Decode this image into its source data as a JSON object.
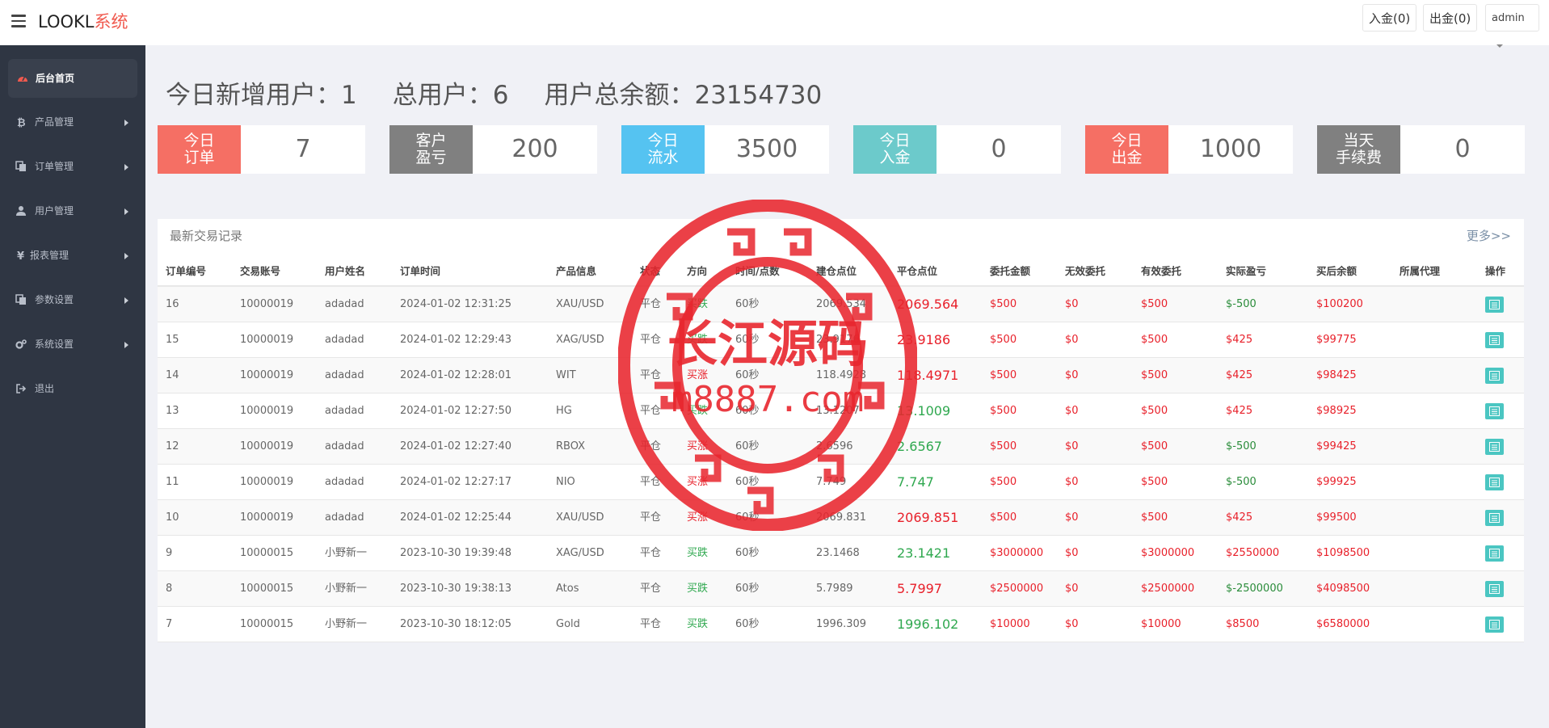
{
  "header": {
    "brand_main": "LOOKL",
    "brand_accent": "系统",
    "deposit_label": "入金(0)",
    "withdraw_label": "出金(0)",
    "admin_label": "admin"
  },
  "sidebar": {
    "items": [
      {
        "label": "后台首页",
        "icon": "dashboard-icon"
      },
      {
        "label": "产品管理",
        "icon": "bitcoin-icon"
      },
      {
        "label": "订单管理",
        "icon": "copy-icon"
      },
      {
        "label": "用户管理",
        "icon": "user-icon"
      },
      {
        "label": "报表管理",
        "icon": "yen-icon"
      },
      {
        "label": "参数设置",
        "icon": "copy-icon"
      },
      {
        "label": "系统设置",
        "icon": "cogs-icon"
      },
      {
        "label": "退出",
        "icon": "logout-icon"
      }
    ]
  },
  "stats": {
    "new_users": "今日新增用户：1",
    "total_users": "总用户：6",
    "total_balance": "用户总余额：23154730"
  },
  "cards": [
    {
      "label": "今日\n订单",
      "value": "7",
      "color": "#f56f64"
    },
    {
      "label": "客户\n盈亏",
      "value": "200",
      "color": "#808080"
    },
    {
      "label": "今日\n流水",
      "value": "3500",
      "color": "#55c3f1"
    },
    {
      "label": "今日\n入金",
      "value": "0",
      "color": "#6ccacb"
    },
    {
      "label": "今日\n出金",
      "value": "1000",
      "color": "#f56f64"
    },
    {
      "label": "当天\n手续费",
      "value": "0",
      "color": "#808080"
    }
  ],
  "trades": {
    "title": "最新交易记录",
    "more": "更多>>",
    "columns": [
      "订单编号",
      "交易账号",
      "用户姓名",
      "订单时间",
      "产品信息",
      "状态",
      "方向",
      "时间/点数",
      "建仓点位",
      "平仓点位",
      "委托金额",
      "无效委托",
      "有效委托",
      "实际盈亏",
      "买后余额",
      "所属代理",
      "操作"
    ],
    "rows": [
      [
        "16",
        "10000019",
        "adadad",
        "2024-01-02 12:31:25",
        "XAU/USD",
        "平仓",
        "买跌",
        "60秒",
        "2069.534",
        "2069.564",
        "$500",
        "$0",
        "$500",
        "$-500",
        "$100200",
        ""
      ],
      [
        "15",
        "10000019",
        "adadad",
        "2024-01-02 12:29:43",
        "XAG/USD",
        "平仓",
        "买跌",
        "60秒",
        "23.9176",
        "23.9186",
        "$500",
        "$0",
        "$500",
        "$425",
        "$99775",
        ""
      ],
      [
        "14",
        "10000019",
        "adadad",
        "2024-01-02 12:28:01",
        "WIT",
        "平仓",
        "买涨",
        "60秒",
        "118.4928",
        "118.4971",
        "$500",
        "$0",
        "$500",
        "$425",
        "$98425",
        ""
      ],
      [
        "13",
        "10000019",
        "adadad",
        "2024-01-02 12:27:50",
        "HG",
        "平仓",
        "买跌",
        "60秒",
        "13.1207",
        "13.1009",
        "$500",
        "$0",
        "$500",
        "$425",
        "$98925",
        ""
      ],
      [
        "12",
        "10000019",
        "adadad",
        "2024-01-02 12:27:40",
        "RBOX",
        "平仓",
        "买涨",
        "60秒",
        "2.6596",
        "2.6567",
        "$500",
        "$0",
        "$500",
        "$-500",
        "$99425",
        ""
      ],
      [
        "11",
        "10000019",
        "adadad",
        "2024-01-02 12:27:17",
        "NIO",
        "平仓",
        "买涨",
        "60秒",
        "7.749",
        "7.747",
        "$500",
        "$0",
        "$500",
        "$-500",
        "$99925",
        ""
      ],
      [
        "10",
        "10000019",
        "adadad",
        "2024-01-02 12:25:44",
        "XAU/USD",
        "平仓",
        "买涨",
        "60秒",
        "2069.831",
        "2069.851",
        "$500",
        "$0",
        "$500",
        "$425",
        "$99500",
        ""
      ],
      [
        "9",
        "10000015",
        "小野新一",
        "2023-10-30 19:39:48",
        "XAG/USD",
        "平仓",
        "买跌",
        "60秒",
        "23.1468",
        "23.1421",
        "$3000000",
        "$0",
        "$3000000",
        "$2550000",
        "$1098500",
        ""
      ],
      [
        "8",
        "10000015",
        "小野新一",
        "2023-10-30 19:38:13",
        "Atos",
        "平仓",
        "买跌",
        "60秒",
        "5.7989",
        "5.7997",
        "$2500000",
        "$0",
        "$2500000",
        "$-2500000",
        "$4098500",
        ""
      ],
      [
        "7",
        "10000015",
        "小野新一",
        "2023-10-30 18:12:05",
        "Gold",
        "平仓",
        "买跌",
        "60秒",
        "1996.309",
        "1996.102",
        "$10000",
        "$0",
        "$10000",
        "$8500",
        "$6580000",
        ""
      ]
    ],
    "close_colors": [
      "#e8202a",
      "#e8202a",
      "#e8202a",
      "#2fa84f",
      "#2fa84f",
      "#2fa84f",
      "#e8202a",
      "#2fa84f",
      "#e8202a",
      "#2fa84f"
    ],
    "direction_colors": {
      "买跌": "#2fa84f",
      "买涨": "#e8202a"
    },
    "profit_colors": {
      "neg": "#2a8c3a",
      "pos": "#e8202a"
    }
  },
  "watermark": {
    "title": "长江源码",
    "url": "m8887.com",
    "color": "#e8262e"
  }
}
